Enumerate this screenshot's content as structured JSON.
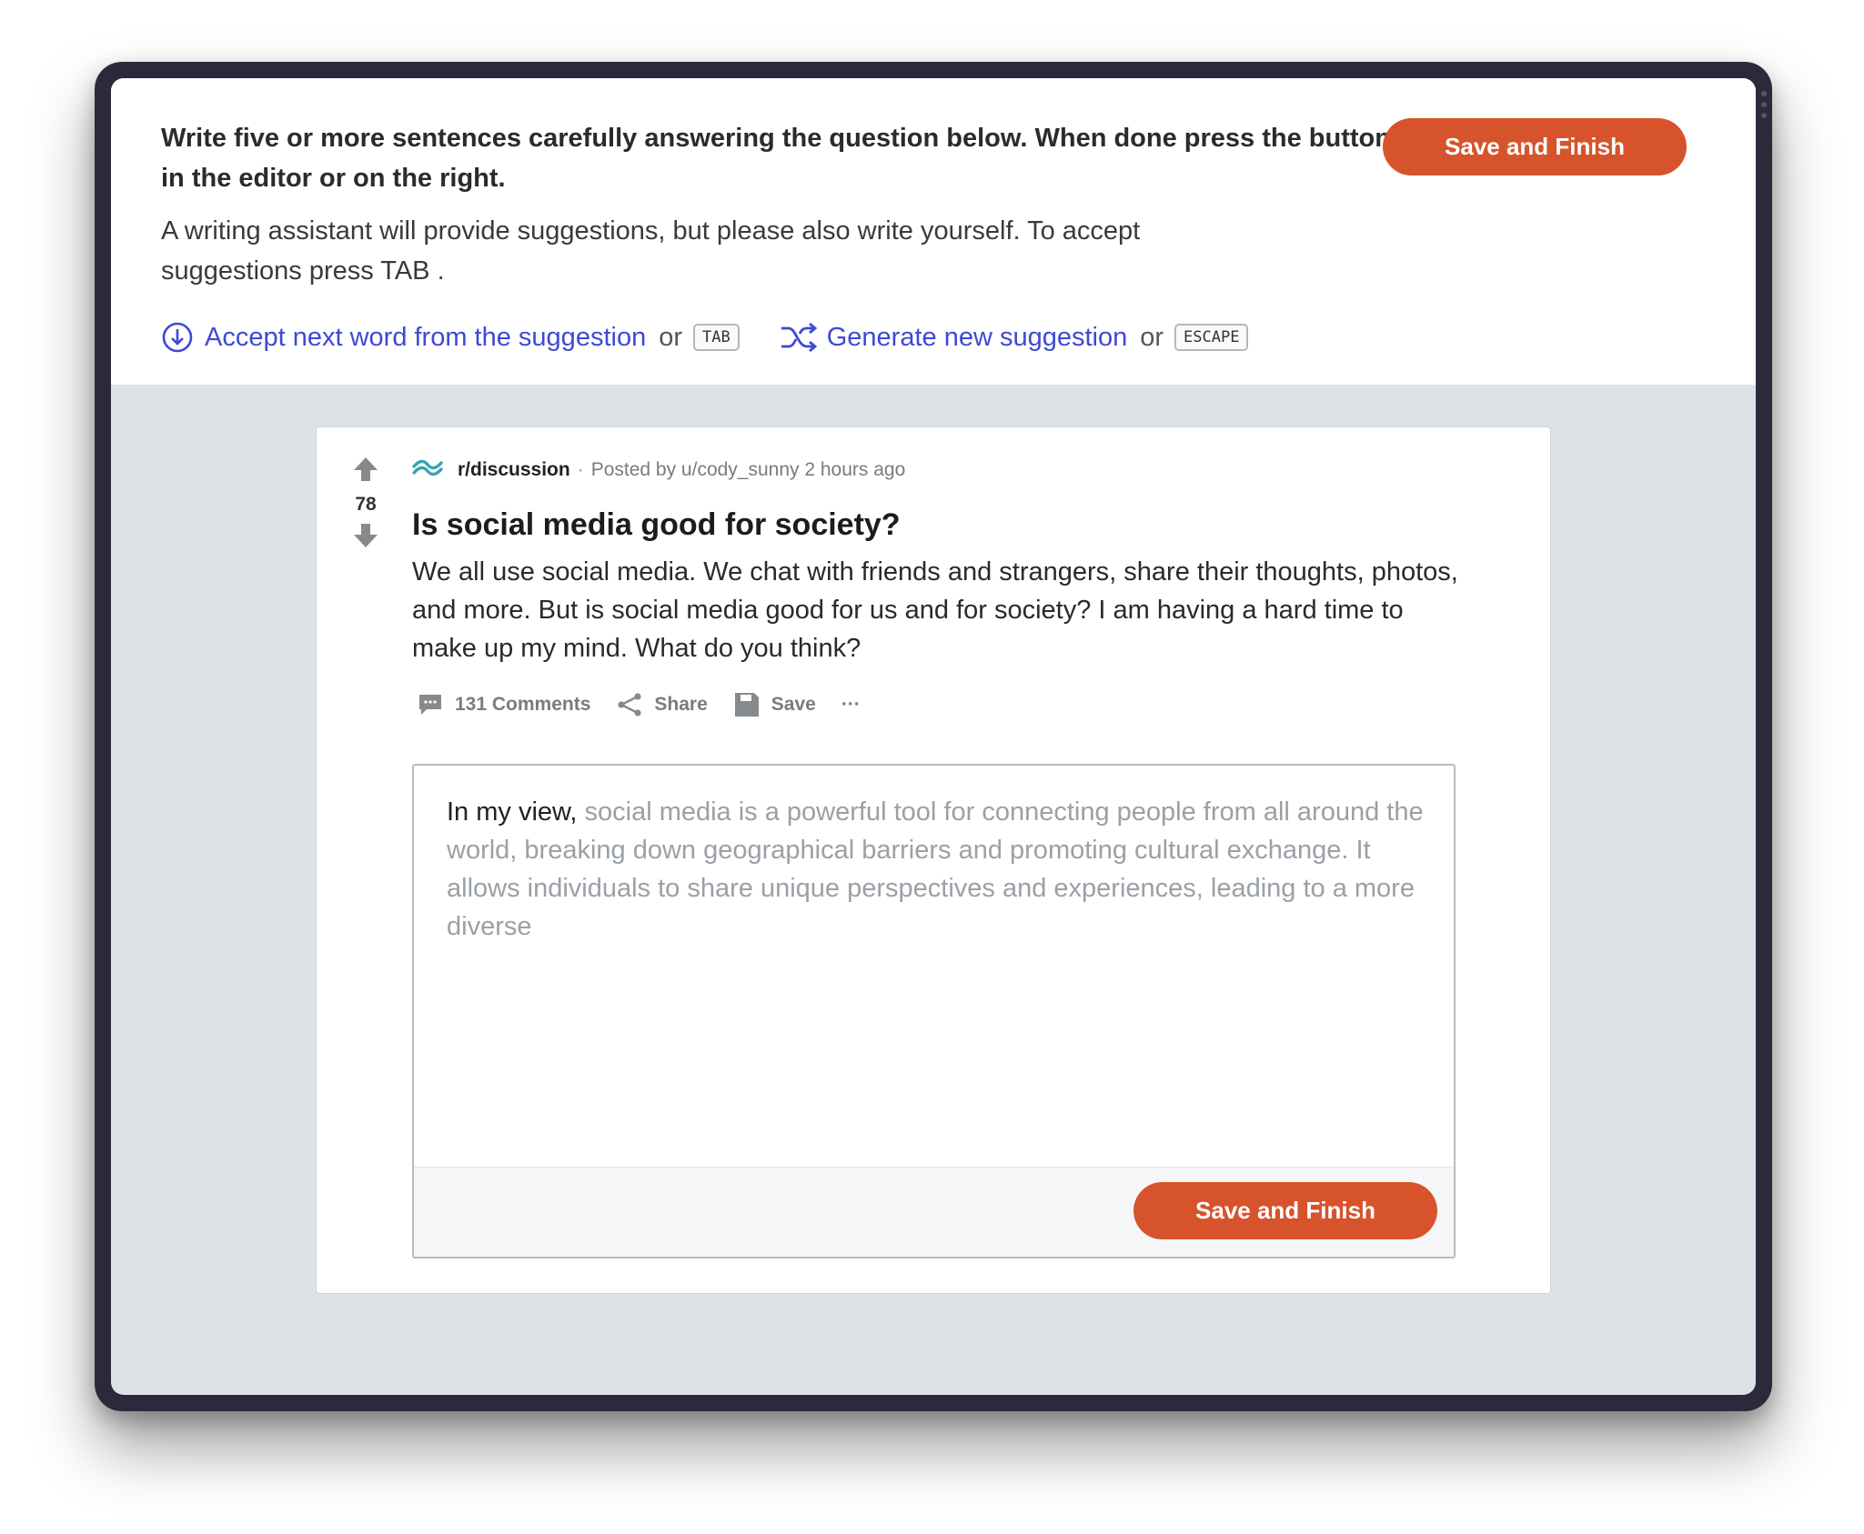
{
  "instructions": {
    "bold": "Write five or more sentences carefully answering the question below. When done press the button in the editor or on the right.",
    "normal": "A writing assistant will provide suggestions, but please also write yourself. To accept suggestions press TAB ."
  },
  "header": {
    "save_label": "Save and Finish"
  },
  "hints": {
    "accept_label": "Accept next word from the suggestion",
    "or1": "or",
    "accept_key": "TAB",
    "generate_label": "Generate new suggestion",
    "or2": "or",
    "generate_key": "ESCAPE",
    "accent_color": "#3d49d4"
  },
  "post": {
    "vote_count": "78",
    "subreddit": "r/discussion",
    "separator": "·",
    "posted_by": "Posted by u/cody_sunny 2 hours ago",
    "title": "Is social media good for society?",
    "body": "We all use social media. We chat with friends and strangers, share their thoughts, photos, and more. But is social media good for us and for society? I am having a hard time to make up my mind. What do you think?",
    "comments_label": "131 Comments",
    "share_label": "Share",
    "save_label": "Save",
    "more_label": "···"
  },
  "editor": {
    "typed_text": "In my view, ",
    "suggestion_text": "social media is a powerful tool for connecting people from all around the world, breaking down geographical barriers and promoting cultural exchange. It allows individuals to share unique perspectives and experiences, leading to a more diverse",
    "save_label": "Save and Finish"
  },
  "colors": {
    "primary_button": "#d6532b",
    "page_background": "#dde2e7",
    "suggestion_text": "#9aa0a6"
  }
}
